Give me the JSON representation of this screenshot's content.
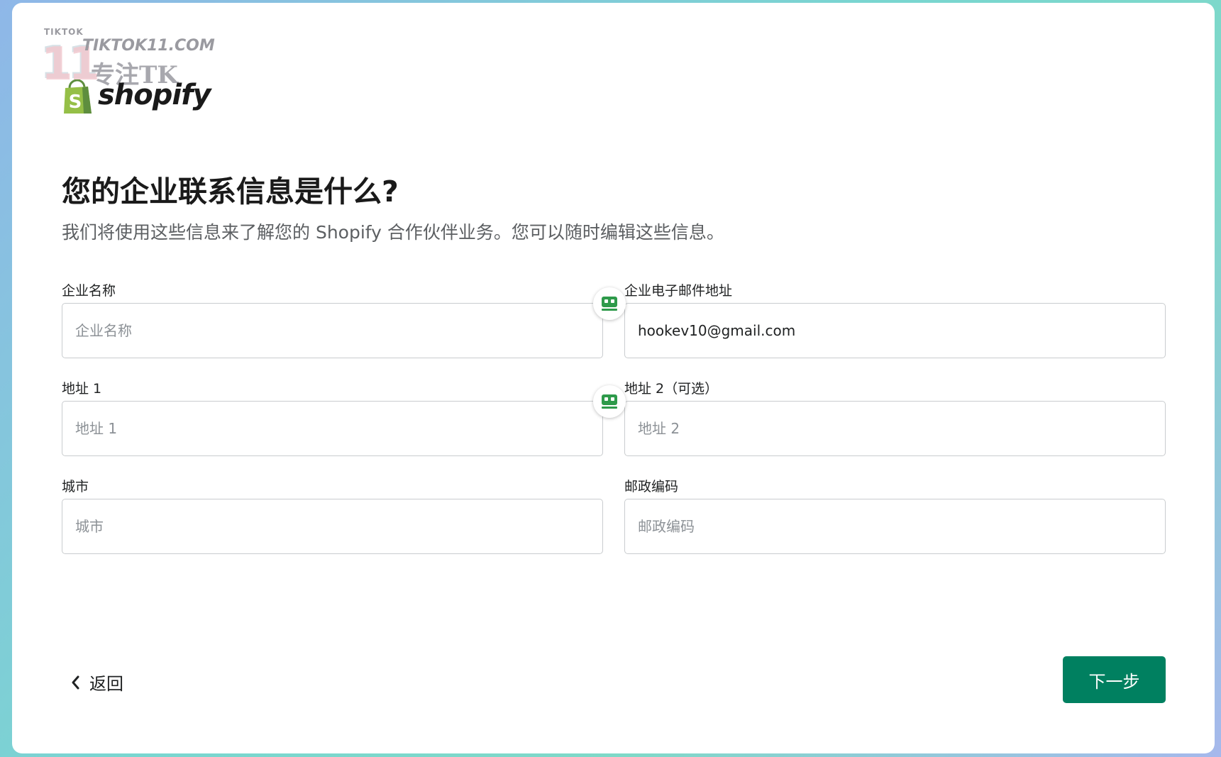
{
  "watermark": {
    "small": "TIKTOK",
    "number": "11",
    "site": "TIKTOK11.COM",
    "tagline": "专注TK"
  },
  "brand": {
    "name": "shopify",
    "icon": "shopify-bag-icon",
    "color": "#95bf47"
  },
  "heading": {
    "title": "您的企业联系信息是什么?",
    "subtitle": "我们将使用这些信息来了解您的 Shopify 合作伙伴业务。您可以随时编辑这些信息。"
  },
  "form": {
    "company_name": {
      "label": "企业名称",
      "placeholder": "企业名称",
      "value": ""
    },
    "business_email": {
      "label": "企业电子邮件地址",
      "placeholder": "",
      "value": "hookev10@gmail.com"
    },
    "address1": {
      "label": "地址 1",
      "placeholder": "地址 1",
      "value": ""
    },
    "address2": {
      "label": "地址 2（可选）",
      "placeholder": "地址 2",
      "value": ""
    },
    "city": {
      "label": "城市",
      "placeholder": "城市",
      "value": ""
    },
    "postal_code": {
      "label": "邮政编码",
      "placeholder": "邮政编码",
      "value": ""
    },
    "autofill_icon": "password-manager-icon"
  },
  "nav": {
    "back_label": "返回",
    "next_label": "下一步",
    "primary_color": "#008060"
  }
}
